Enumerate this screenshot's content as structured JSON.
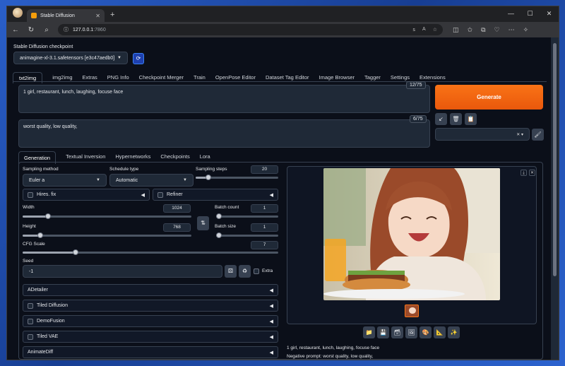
{
  "browser": {
    "tab_title": "Stable Diffusion",
    "url_host": "127.0.0.1",
    "url_port": ":7860"
  },
  "checkpoint": {
    "label": "Stable Diffusion checkpoint",
    "value": "animagine-xl-3.1.safetensors [e3c47aedb0]"
  },
  "main_tabs": [
    "txt2img",
    "img2img",
    "Extras",
    "PNG Info",
    "Checkpoint Merger",
    "Train",
    "OpenPose Editor",
    "Dataset Tag Editor",
    "Image Browser",
    "Tagger",
    "Settings",
    "Extensions"
  ],
  "prompt": {
    "positive": "1 girl, restaurant, lunch, laughing, focuse face",
    "positive_tokens": "12/75",
    "negative": "worst quality, low quality,",
    "negative_tokens": "6/75"
  },
  "generate_label": "Generate",
  "sub_tabs": [
    "Generation",
    "Textual Inversion",
    "Hypernetworks",
    "Checkpoints",
    "Lora"
  ],
  "params": {
    "sampling_method_label": "Sampling method",
    "sampling_method": "Euler a",
    "schedule_type_label": "Schedule type",
    "schedule_type": "Automatic",
    "sampling_steps_label": "Sampling steps",
    "sampling_steps": "20",
    "hires_label": "Hires. fix",
    "refiner_label": "Refiner",
    "width_label": "Width",
    "width": "1024",
    "height_label": "Height",
    "height": "768",
    "batch_count_label": "Batch count",
    "batch_count": "1",
    "batch_size_label": "Batch size",
    "batch_size": "1",
    "cfg_label": "CFG Scale",
    "cfg": "7",
    "seed_label": "Seed",
    "seed": "-1",
    "extra_label": "Extra",
    "steps_frac": 0.13,
    "width_frac": 0.14,
    "height_frac": 0.09,
    "batch_count_frac": 0.0,
    "batch_size_frac": 0.0,
    "cfg_frac": 0.2
  },
  "accordions": {
    "adetailer": "ADetailer",
    "tiled_diffusion": "Tiled Diffusion",
    "demofusion": "DemoFusion",
    "tiled_vae": "Tiled VAE",
    "animatediff": "AnimateDiff"
  },
  "output": {
    "prompt_line": "1 girl, restaurant, lunch, laughing, focuse face",
    "negative_line": "Negative prompt: worst quality, low quality,"
  },
  "colors": {
    "generate": "#ea580c",
    "accent": "#3b82f6"
  }
}
